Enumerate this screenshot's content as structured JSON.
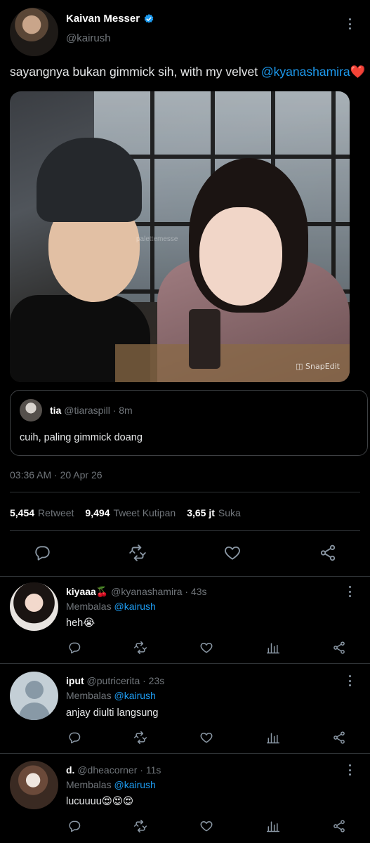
{
  "tweet": {
    "author_name": "Kaivan Messer",
    "author_handle": "@kairush",
    "text_plain": "sayangnya bukan gimmick sih, with my velvet ",
    "text_mention": "@kyanashamira",
    "text_emoji": "❤️",
    "photo_watermark": "SnapEdit",
    "photo_watermark_top": "palettemesse",
    "timestamp": "03:36 AM · 20 Apr 26",
    "stats": {
      "retweets_value": "5,454",
      "retweets_label": "Retweet",
      "quotes_value": "9,494",
      "quotes_label": "Tweet Kutipan",
      "likes_value": "3,65 jt",
      "likes_label": "Suka"
    }
  },
  "quoted_tweet": {
    "name": "tia",
    "handle": "@tiaraspill",
    "time": "· 8m",
    "text": "cuih, paling gimmick doang"
  },
  "replies": [
    {
      "name": "kiyaaa🍒",
      "handle": "@kyanashamira",
      "time": "· 43s",
      "replying_label": "Membalas",
      "replying_to": "@kairush",
      "text": "heh😭"
    },
    {
      "name": "iput",
      "handle": "@putricerita",
      "time": "· 23s",
      "replying_label": "Membalas",
      "replying_to": "@kairush",
      "text": "anjay diulti langsung"
    },
    {
      "name": "d.",
      "handle": "@dheacorner",
      "time": "· 11s",
      "replying_label": "Membalas",
      "replying_to": "@kairush",
      "text": "lucuuuu😍😍😍"
    }
  ],
  "colors": {
    "background": "#000000",
    "link": "#1d9bf0",
    "muted": "#71767b",
    "verified": "#1d9bf0"
  },
  "icons": {
    "actions": [
      "reply-icon",
      "retweet-icon",
      "like-icon",
      "share-icon"
    ],
    "reply_actions": [
      "reply-icon",
      "retweet-icon",
      "like-icon",
      "analytics-icon",
      "share-icon"
    ]
  }
}
